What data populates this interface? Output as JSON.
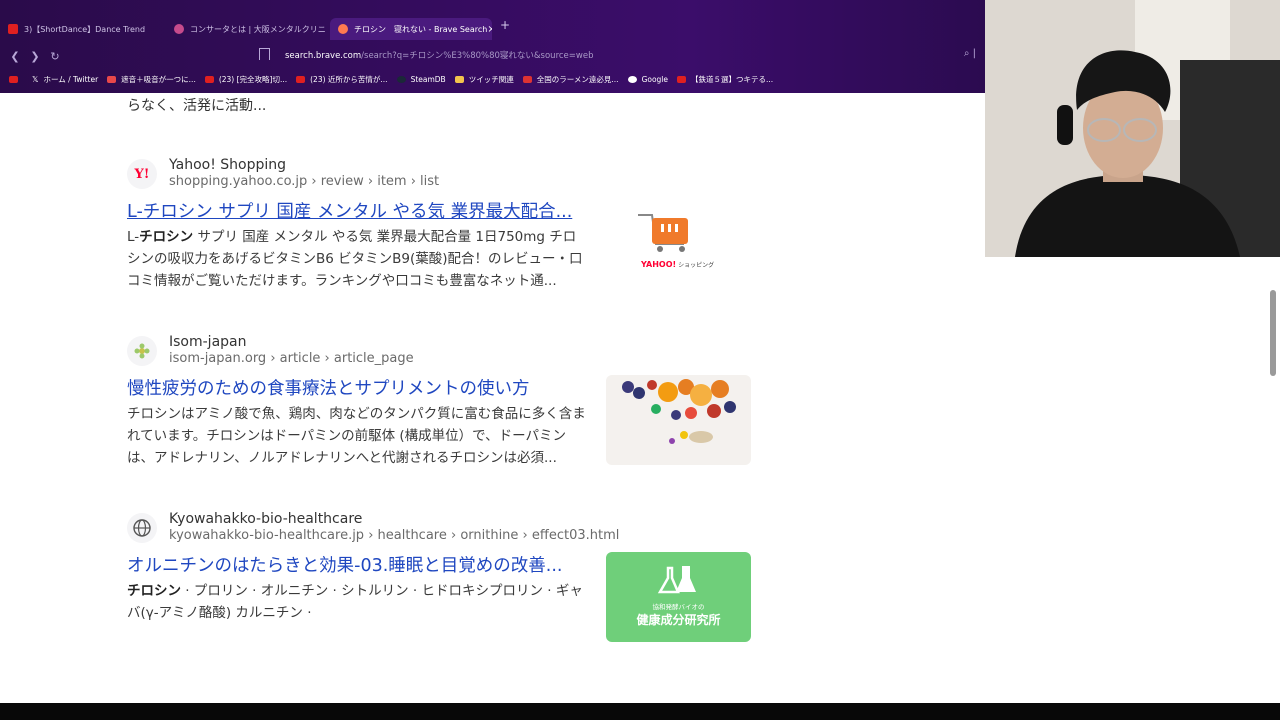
{
  "browser": {
    "tabs": [
      {
        "title": "3)【ShortDance】Dance Trend"
      },
      {
        "title": "コンサータとは | 大阪メンタルクリニック"
      },
      {
        "title": "チロシン　寝れない - Brave Search",
        "close": "×"
      }
    ],
    "new_tab": "+",
    "address": {
      "host": "search.brave.com",
      "path": "/search?q=チロシン%E3%80%80寝れない&source=web"
    },
    "bookmarks": [
      "",
      "ホーム / Twitter",
      "遮音＋吸音が一つに...",
      "(23) [完全攻略]切...",
      "(23) 近所から苦情が...",
      "SteamDB",
      "ツイッチ関連",
      "全国のラーメン遠必見...",
      "Google",
      "【鉄道５選】つキテる..."
    ]
  },
  "content": {
    "prev_snippet": "らなく、活発に活動...",
    "results": [
      {
        "site_name": "Yahoo! Shopping",
        "url": "shopping.yahoo.co.jp › review › item › list",
        "title": "L-チロシン サプリ 国産 メンタル やる気 業界最大配合...",
        "desc_pre": "L-",
        "desc_bold": "チロシン",
        "desc_post": " サプリ 国産 メンタル やる気 業界最大配合量 1日750mg チロシンの吸収力をあげるビタミンB6 ビタミンB9(葉酸)配合！のレビュー・口コミ情報がご覧いただけます。ランキングや口コミも豊富なネット通...",
        "thumb_logo": "YAHOO!",
        "thumb_sub": "ショッピング"
      },
      {
        "site_name": "Isom-japan",
        "url": "isom-japan.org › article › article_page",
        "title": "慢性疲労のための食事療法とサプリメントの使い方",
        "desc_pre": "",
        "desc_bold": "",
        "desc_post": "チロシンはアミノ酸で魚、鶏肉、肉などのタンパク質に富む食品に多く含まれています。チロシンはドーパミンの前駆体 (構成単位）で、ドーパミンは、アドレナリン、ノルアドレナリンへと代謝されるチロシンは必須..."
      },
      {
        "site_name": "Kyowahakko-bio-healthcare",
        "url": "kyowahakko-bio-healthcare.jp › healthcare › ornithine › effect03.html",
        "title": "オルニチンのはたらきと効果-03.睡眠と目覚めの改善...",
        "desc_pre": "",
        "desc_bold": "チロシン",
        "desc_post": " · プロリン · オルニチン · シトルリン · ヒドロキシプロリン · ギャバ(γ-アミノ酪酸) カルニチン ·",
        "thumb_line1": "協和発酵バイオの",
        "thumb_line2": "健康成分研究所"
      }
    ]
  },
  "colors": {
    "chrome": "#3b0d6a",
    "link": "#1f47c0",
    "yahoo_red": "#ff0033",
    "cart_orange": "#f07a2b",
    "kyowa_green": "#6fcf7a"
  }
}
